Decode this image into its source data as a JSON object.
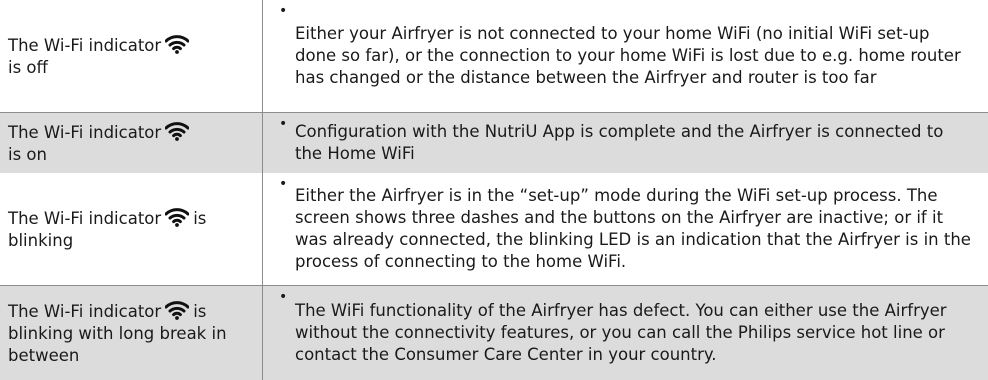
{
  "rows": [
    {
      "condition_prefix": "The Wi-Fi indicator",
      "condition_suffix": "is off",
      "icon": "wifi-icon",
      "description": "Either your Airfryer is not connected to your home WiFi (no initial WiFi set-up done so far), or the connection to your home WiFi is lost due to e.g. home router has changed or the distance between the Airfryer and router is too far"
    },
    {
      "condition_prefix": "The Wi-Fi indicator",
      "condition_suffix": "is on",
      "icon": "wifi-icon",
      "description": "Configuration with the NutriU App is complete and the Airfryer is connected to the Home WiFi"
    },
    {
      "condition_prefix": "The Wi-Fi indicator",
      "condition_suffix": "is blinking",
      "icon": "wifi-icon",
      "description": "Either the Airfryer is in the “set-up” mode during the WiFi set-up process. The screen shows three dashes and the buttons on the Airfryer are inactive; or if it was already connected, the blinking LED is an indication that the Airfryer is in the process of connecting to the home WiFi."
    },
    {
      "condition_prefix": "The Wi-Fi indicator",
      "condition_suffix": "is blinking with long break in between",
      "icon": "wifi-icon",
      "description": "The WiFi functionality of the Airfryer has defect. You can either use the Airfryer without the connectivity features, or you can call the Philips service hot line or contact the Consumer Care Center in your country."
    }
  ],
  "colors": {
    "shaded_row": "#dcdcdc",
    "divider": "#8c8c8c",
    "text": "#1a1a1a"
  }
}
